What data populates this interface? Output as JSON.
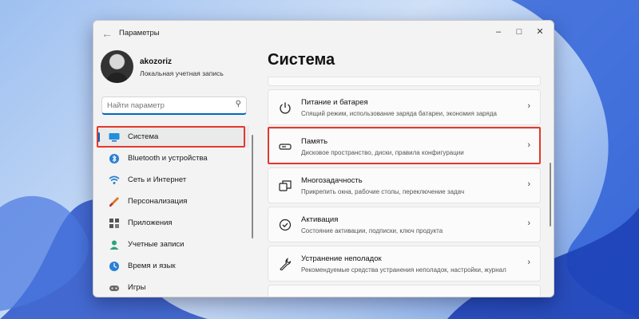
{
  "window": {
    "title": "Параметры"
  },
  "user": {
    "name": "akozoriz",
    "account_type": "Локальная учетная запись"
  },
  "search": {
    "placeholder": "Найти параметр"
  },
  "sidebar": {
    "items": [
      {
        "label": "Система",
        "icon": "monitor-icon",
        "active": true
      },
      {
        "label": "Bluetooth и устройства",
        "icon": "bluetooth-icon"
      },
      {
        "label": "Сеть и Интернет",
        "icon": "wifi-icon"
      },
      {
        "label": "Персонализация",
        "icon": "brush-icon"
      },
      {
        "label": "Приложения",
        "icon": "apps-icon"
      },
      {
        "label": "Учетные записи",
        "icon": "person-icon"
      },
      {
        "label": "Время и язык",
        "icon": "globe-clock-icon"
      },
      {
        "label": "Игры",
        "icon": "gamepad-icon"
      }
    ]
  },
  "main": {
    "title": "Система",
    "cards": [
      {
        "title": "Питание и батарея",
        "subtitle": "Спящий режим, использование заряда батареи, экономия заряда",
        "icon": "power-icon"
      },
      {
        "title": "Память",
        "subtitle": "Дисковое пространство, диски, правила конфигурации",
        "icon": "storage-icon"
      },
      {
        "title": "Многозадачность",
        "subtitle": "Прикрепить окна, рабочие столы, переключение задач",
        "icon": "multitask-icon"
      },
      {
        "title": "Активация",
        "subtitle": "Состояние активации, подписки, ключ продукта",
        "icon": "check-circle-icon"
      },
      {
        "title": "Устранение неполадок",
        "subtitle": "Рекомендуемые средства устранения неполадок, настройки, журнал",
        "icon": "wrench-icon"
      }
    ]
  },
  "colors": {
    "accent": "#0067c0",
    "highlight": "#e4382c"
  }
}
